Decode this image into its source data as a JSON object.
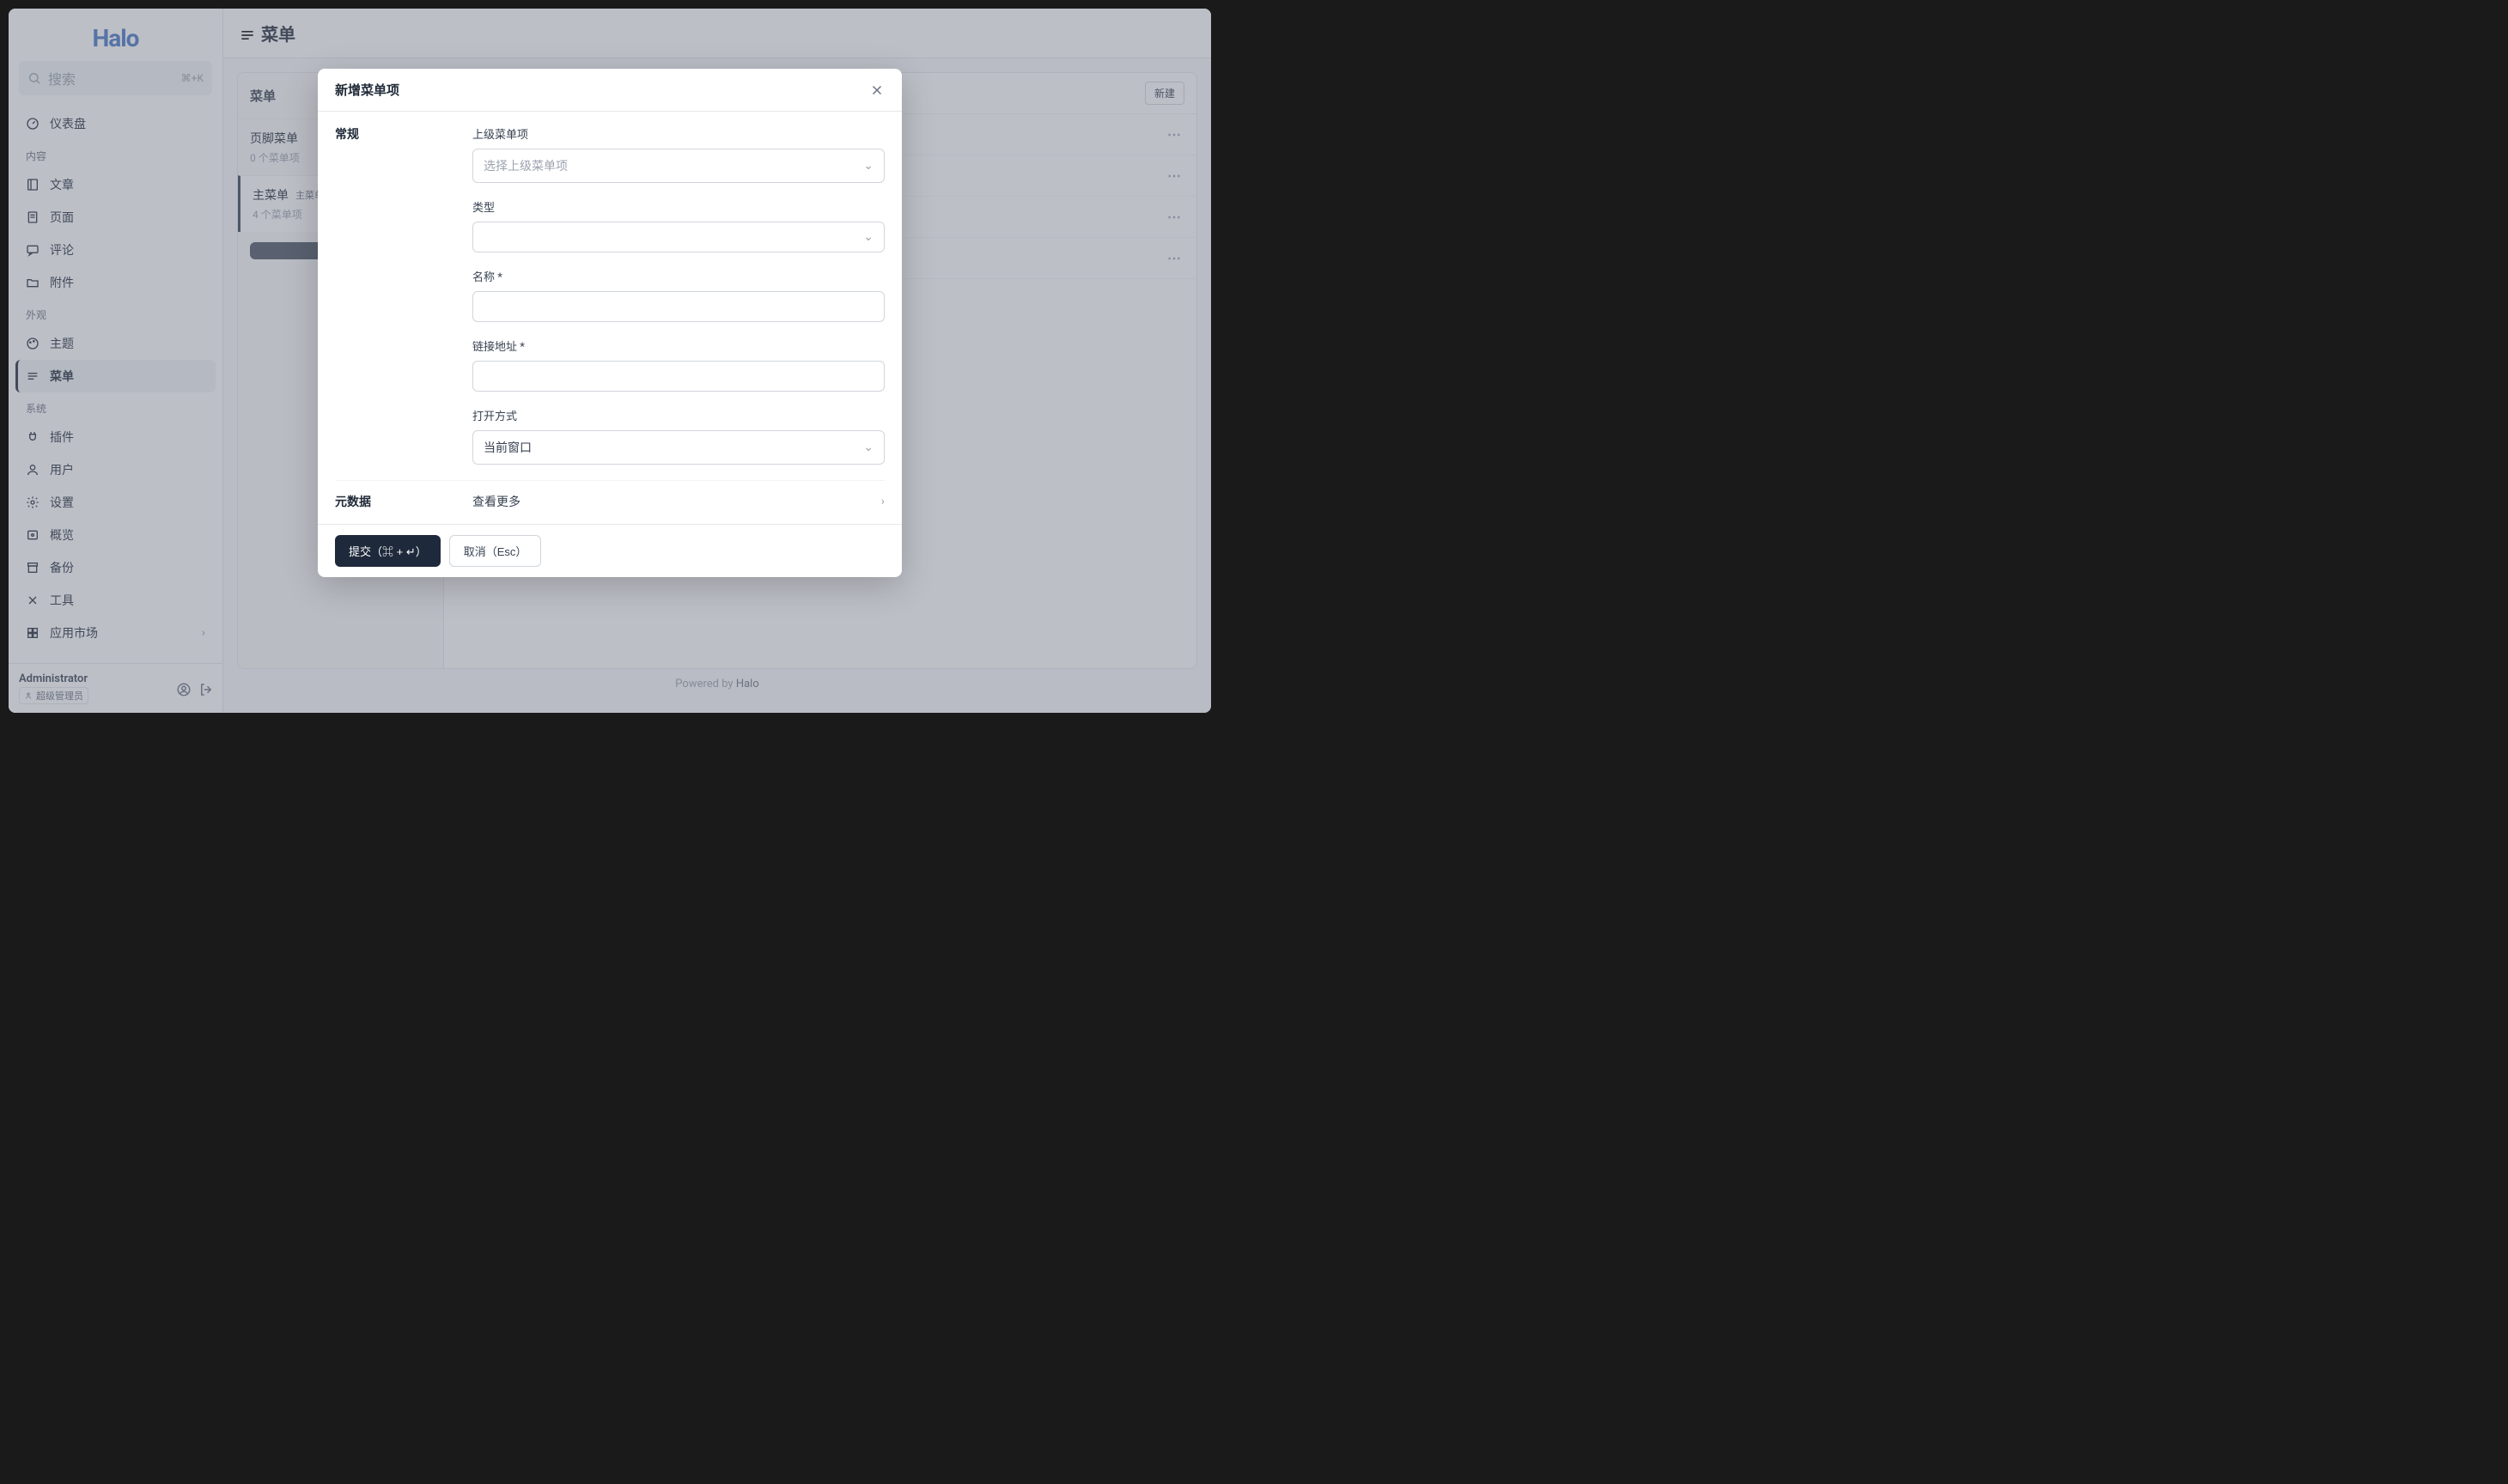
{
  "logo": "Halo",
  "search": {
    "placeholder": "搜索",
    "shortcut": "⌘+K"
  },
  "sidebar": {
    "dashboard": "仪表盘",
    "groups": {
      "content": {
        "title": "内容",
        "items": {
          "posts": "文章",
          "pages": "页面",
          "comments": "评论",
          "attachments": "附件"
        }
      },
      "appearance": {
        "title": "外观",
        "items": {
          "themes": "主题",
          "menus": "菜单"
        }
      },
      "system": {
        "title": "系统",
        "items": {
          "plugins": "插件",
          "users": "用户",
          "settings": "设置",
          "overview": "概览",
          "backup": "备份",
          "tools": "工具",
          "marketplace": "应用市场"
        }
      }
    }
  },
  "user": {
    "name": "Administrator",
    "role": "超级管理员"
  },
  "page": {
    "title": "菜单"
  },
  "menuGroups": {
    "heading": "菜单",
    "items": [
      {
        "name": "页脚菜单",
        "count": "0 个菜单项"
      },
      {
        "name": "主菜单",
        "badge": "主菜单",
        "count": "4 个菜单项"
      }
    ],
    "newBtn": " "
  },
  "itemsArea": {
    "newBtn": "新建"
  },
  "footer": {
    "poweredBy": "Powered by ",
    "brand": "Halo"
  },
  "modal": {
    "title": "新增菜单项",
    "section_general": "常规",
    "fields": {
      "parent": {
        "label": "上级菜单项",
        "placeholder": "选择上级菜单项"
      },
      "type": {
        "label": "类型"
      },
      "name": {
        "label": "名称 ",
        "required": "*"
      },
      "url": {
        "label": "链接地址 ",
        "required": "*"
      },
      "target": {
        "label": "打开方式",
        "value": "当前窗口"
      }
    },
    "section_meta": "元数据",
    "meta_expand": "查看更多",
    "submit": "提交（⌘ + ↵）",
    "cancel": "取消（Esc）"
  }
}
